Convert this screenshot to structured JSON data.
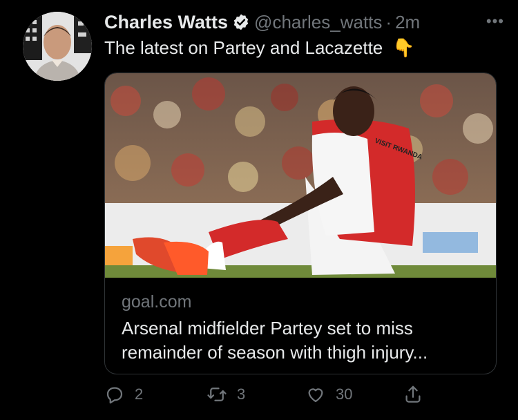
{
  "author": {
    "name": "Charles Watts",
    "handle": "@charles_watts",
    "separator": "·",
    "time": "2m",
    "verified_color": "#e7e9ea"
  },
  "tweet": {
    "text": "The latest on Partey and Lacazette",
    "emoji": "👇"
  },
  "card": {
    "domain": "goal.com",
    "title": "Arsenal midfielder Partey set to miss remainder of season with thigh injury...",
    "image_text": "VISIT RWANDA"
  },
  "actions": {
    "reply_count": "2",
    "retweet_count": "3",
    "like_count": "30"
  },
  "icons": {
    "reply": "reply-icon",
    "retweet": "retweet-icon",
    "like": "heart-icon",
    "share": "share-icon",
    "more": "more-icon"
  },
  "colors": {
    "background": "#000000",
    "text": "#e7e9ea",
    "secondary": "#71767b",
    "border": "#2f3336"
  }
}
